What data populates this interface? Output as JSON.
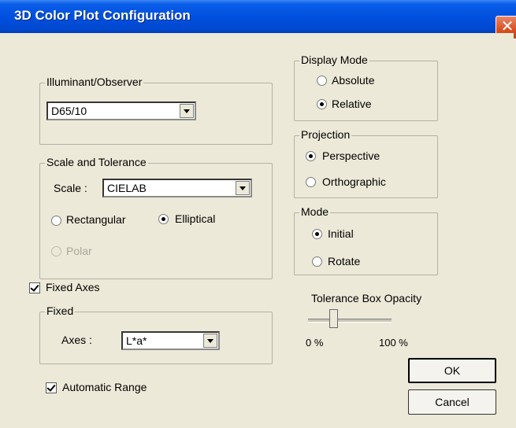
{
  "window": {
    "title": "3D Color Plot Configuration",
    "close_glyph": "✕"
  },
  "illuminant": {
    "legend": "Illuminant/Observer",
    "value": "D65/10"
  },
  "scale": {
    "legend": "Scale and Tolerance",
    "scale_label": "Scale :",
    "scale_value": "CIELAB",
    "rectangular": "Rectangular",
    "elliptical": "Elliptical",
    "polar": "Polar",
    "selected": "Elliptical"
  },
  "fixed_axes": {
    "label": "Fixed Axes",
    "checked": true
  },
  "fixed": {
    "legend": "Fixed",
    "axes_label": "Axes :",
    "axes_value": "L*a*"
  },
  "automatic_range": {
    "label": "Automatic Range",
    "checked": true
  },
  "display_mode": {
    "legend": "Display Mode",
    "absolute": "Absolute",
    "relative": "Relative",
    "selected": "Relative"
  },
  "projection": {
    "legend": "Projection",
    "perspective": "Perspective",
    "orthographic": "Orthographic",
    "selected": "Perspective"
  },
  "mode": {
    "legend": "Mode",
    "initial": "Initial",
    "rotate": "Rotate",
    "selected": "Initial"
  },
  "opacity": {
    "label": "Tolerance Box Opacity",
    "min_label": "0 %",
    "max_label": "100 %",
    "value_fraction": 0.25
  },
  "buttons": {
    "ok": "OK",
    "cancel": "Cancel"
  }
}
